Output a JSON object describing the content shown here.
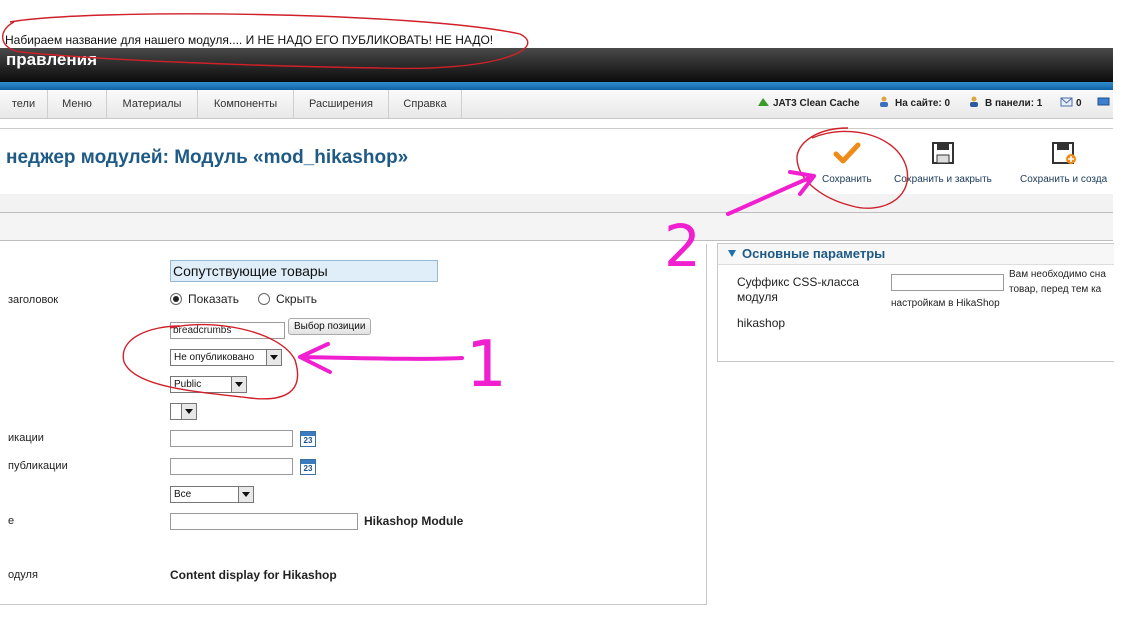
{
  "annotation_note": "Набираем название для нашего модуля.... И НЕ НАДО ЕГО ПУБЛИКОВАТЬ! НЕ НАДО!",
  "header": {
    "title": "правления"
  },
  "menu": [
    "тели",
    "Меню",
    "Материалы",
    "Компоненты",
    "Расширения",
    "Справка"
  ],
  "status": {
    "cache": "JAT3 Clean Cache",
    "on_site": "На сайте: 0",
    "in_panel": "В панели: 1",
    "messages": "0"
  },
  "toolbar": {
    "title": "неджер модулей: Модуль «mod_hikashop»",
    "save": "Сохранить",
    "save_close": "Сохранить и закрыть",
    "save_new": "Сохранить и созда"
  },
  "form": {
    "title_value": "Сопутствующие товары",
    "show_title_label": "заголовок",
    "show_option": "Показать",
    "hide_option": "Скрыть",
    "position_value": "breadcrumbs",
    "position_button": "Выбор позиции",
    "status_value": "Не опубликовано",
    "access_value": "Public",
    "publish_up_label": "икации",
    "publish_down_label": "публикации",
    "language_value": "Все",
    "note_label": "е",
    "module_name": "Hikashop Module",
    "module_type_label": "одуля",
    "module_desc": "Content display for Hikashop"
  },
  "params": {
    "title": "Основные параметры",
    "css_suffix_label_1": "Суффикс CSS-класса",
    "css_suffix_label_2": "модуля",
    "hint_1": "Вам необходимо сна",
    "hint_2": "товар, перед тем ка",
    "hint_3": "настройкам в HikaShop",
    "hikashop_label": "hikashop"
  },
  "annotations": {
    "num1": "1",
    "num2": "2"
  },
  "colors": {
    "marker_red": "#d0202a",
    "marker_magenta": "#f01fd0",
    "title_blue": "#1e5a86"
  }
}
